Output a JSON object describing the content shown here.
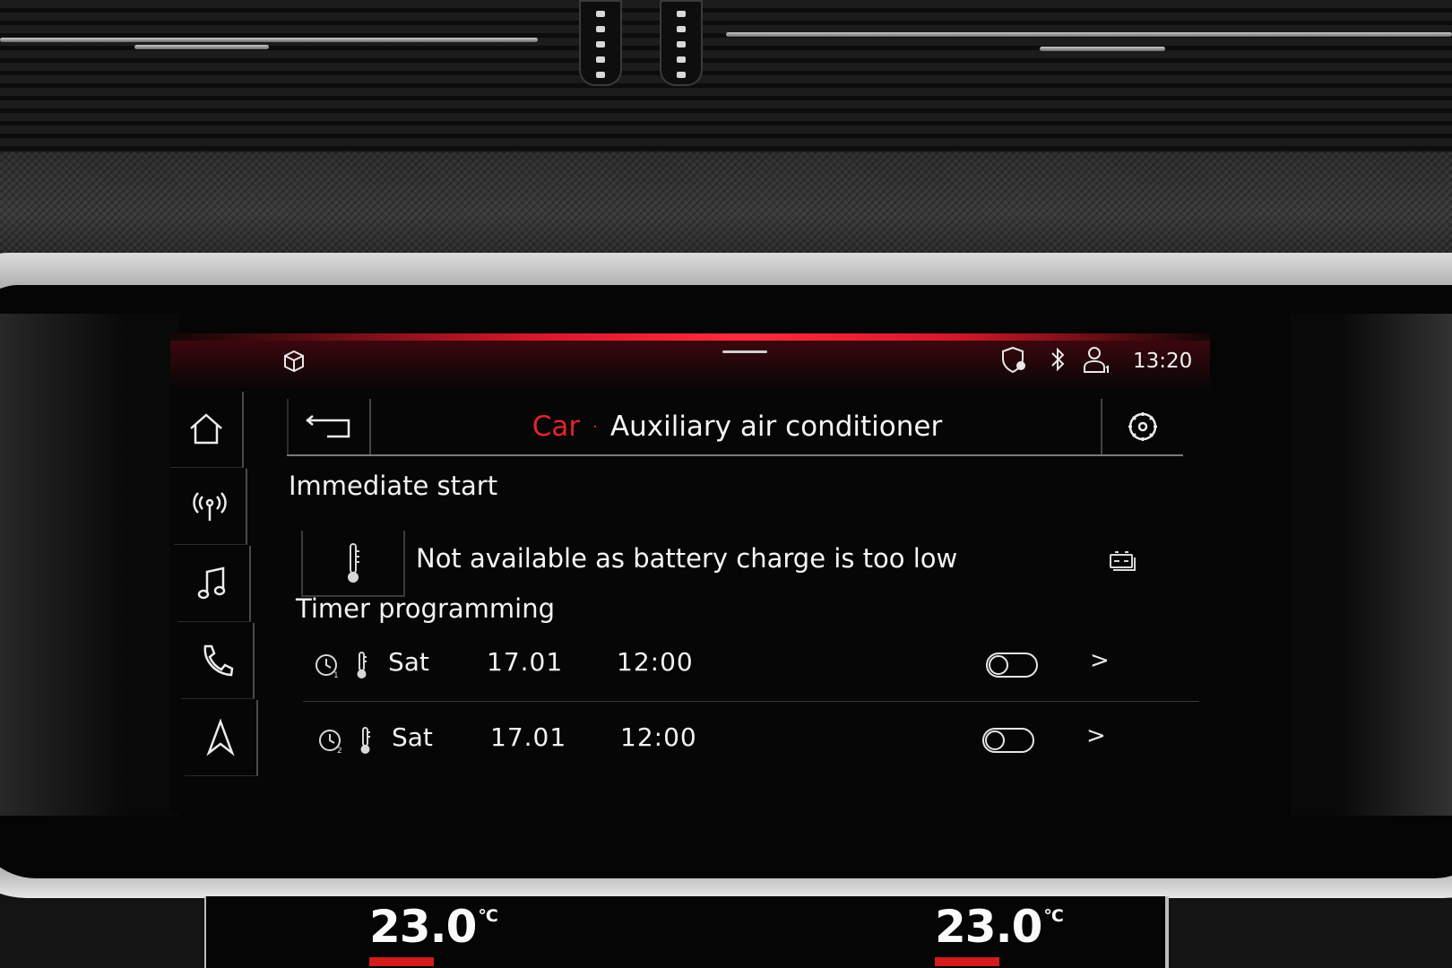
{
  "status_bar": {
    "time": "13:20",
    "icons": [
      "cube-icon",
      "shield-location-icon",
      "bluetooth-icon",
      "user-profile-icon"
    ]
  },
  "side_nav": {
    "items": [
      {
        "name": "home",
        "icon": "home-icon"
      },
      {
        "name": "media-radio",
        "icon": "radio-antenna-icon"
      },
      {
        "name": "music",
        "icon": "music-note-icon"
      },
      {
        "name": "phone",
        "icon": "phone-icon"
      },
      {
        "name": "navigation",
        "icon": "navigation-arrow-icon"
      }
    ]
  },
  "header": {
    "breadcrumb_parent": "Car",
    "breadcrumb_separator": "·",
    "title": "Auxiliary air conditioner"
  },
  "immediate_start": {
    "section_title": "Immediate start",
    "message": "Not available as battery charge is too low"
  },
  "timer_programming": {
    "section_title": "Timer programming",
    "timers": [
      {
        "index": "1",
        "day": "Sat",
        "date": "17.01",
        "time": "12:00",
        "enabled": false
      },
      {
        "index": "2",
        "day": "Sat",
        "date": "17.01",
        "time": "12:00",
        "enabled": false
      }
    ]
  },
  "climate": {
    "left_temp": "23.0",
    "right_temp": "23.0",
    "unit": "°C"
  },
  "colors": {
    "accent_red": "#e3232f",
    "background": "#060606",
    "text": "#f2f2f2"
  }
}
